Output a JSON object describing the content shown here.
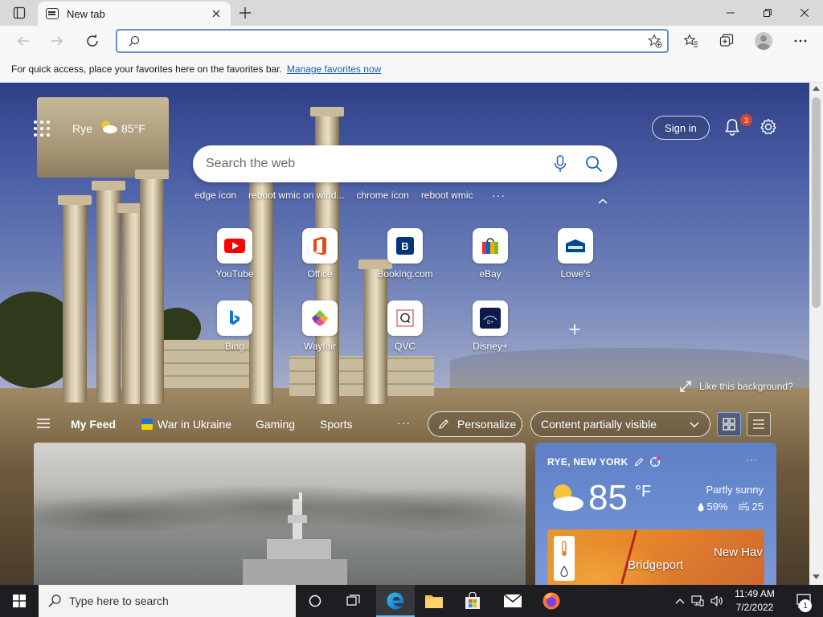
{
  "browser": {
    "tab_title": "New tab",
    "address_placeholder": "",
    "favbar_text": "For quick access, place your favorites here on the favorites bar.",
    "favbar_link": "Manage favorites now"
  },
  "ntp": {
    "location": "Rye",
    "temp_short": "85°F",
    "sign_in": "Sign in",
    "notification_count": "3",
    "search_placeholder": "Search the web",
    "suggestions": [
      "edge icon",
      "reboot wmic on wind...",
      "chrome icon",
      "reboot wmic"
    ],
    "quick_links": [
      {
        "label": "YouTube",
        "icon": "youtube-icon"
      },
      {
        "label": "Office",
        "icon": "office-icon"
      },
      {
        "label": "Booking.com",
        "icon": "booking-icon"
      },
      {
        "label": "eBay",
        "icon": "ebay-icon"
      },
      {
        "label": "Lowe's",
        "icon": "lowes-icon"
      },
      {
        "label": "Bing",
        "icon": "bing-icon"
      },
      {
        "label": "Wayfair",
        "icon": "wayfair-icon"
      },
      {
        "label": "QVC",
        "icon": "qvc-icon"
      },
      {
        "label": "Disney+",
        "icon": "disney-plus-icon"
      }
    ],
    "like_background": "Like this background?",
    "feed_tabs": [
      "My Feed",
      "War in Ukraine",
      "Gaming",
      "Sports"
    ],
    "personalize": "Personalize",
    "content_visibility": "Content partially visible"
  },
  "weather": {
    "location": "RYE, NEW YORK",
    "temp": "85",
    "unit": "°F",
    "condition": "Partly sunny",
    "humidity": "59%",
    "aqi": "25",
    "map_label_1": "Bridgeport",
    "map_label_2": "New Hav"
  },
  "taskbar": {
    "search_placeholder": "Type here to search",
    "time": "11:49 AM",
    "date": "7/2/2022",
    "notifications": "1"
  },
  "colors": {
    "accent": "#0078d4",
    "taskbar": "#1d1d22",
    "badge": "#d4462d"
  }
}
